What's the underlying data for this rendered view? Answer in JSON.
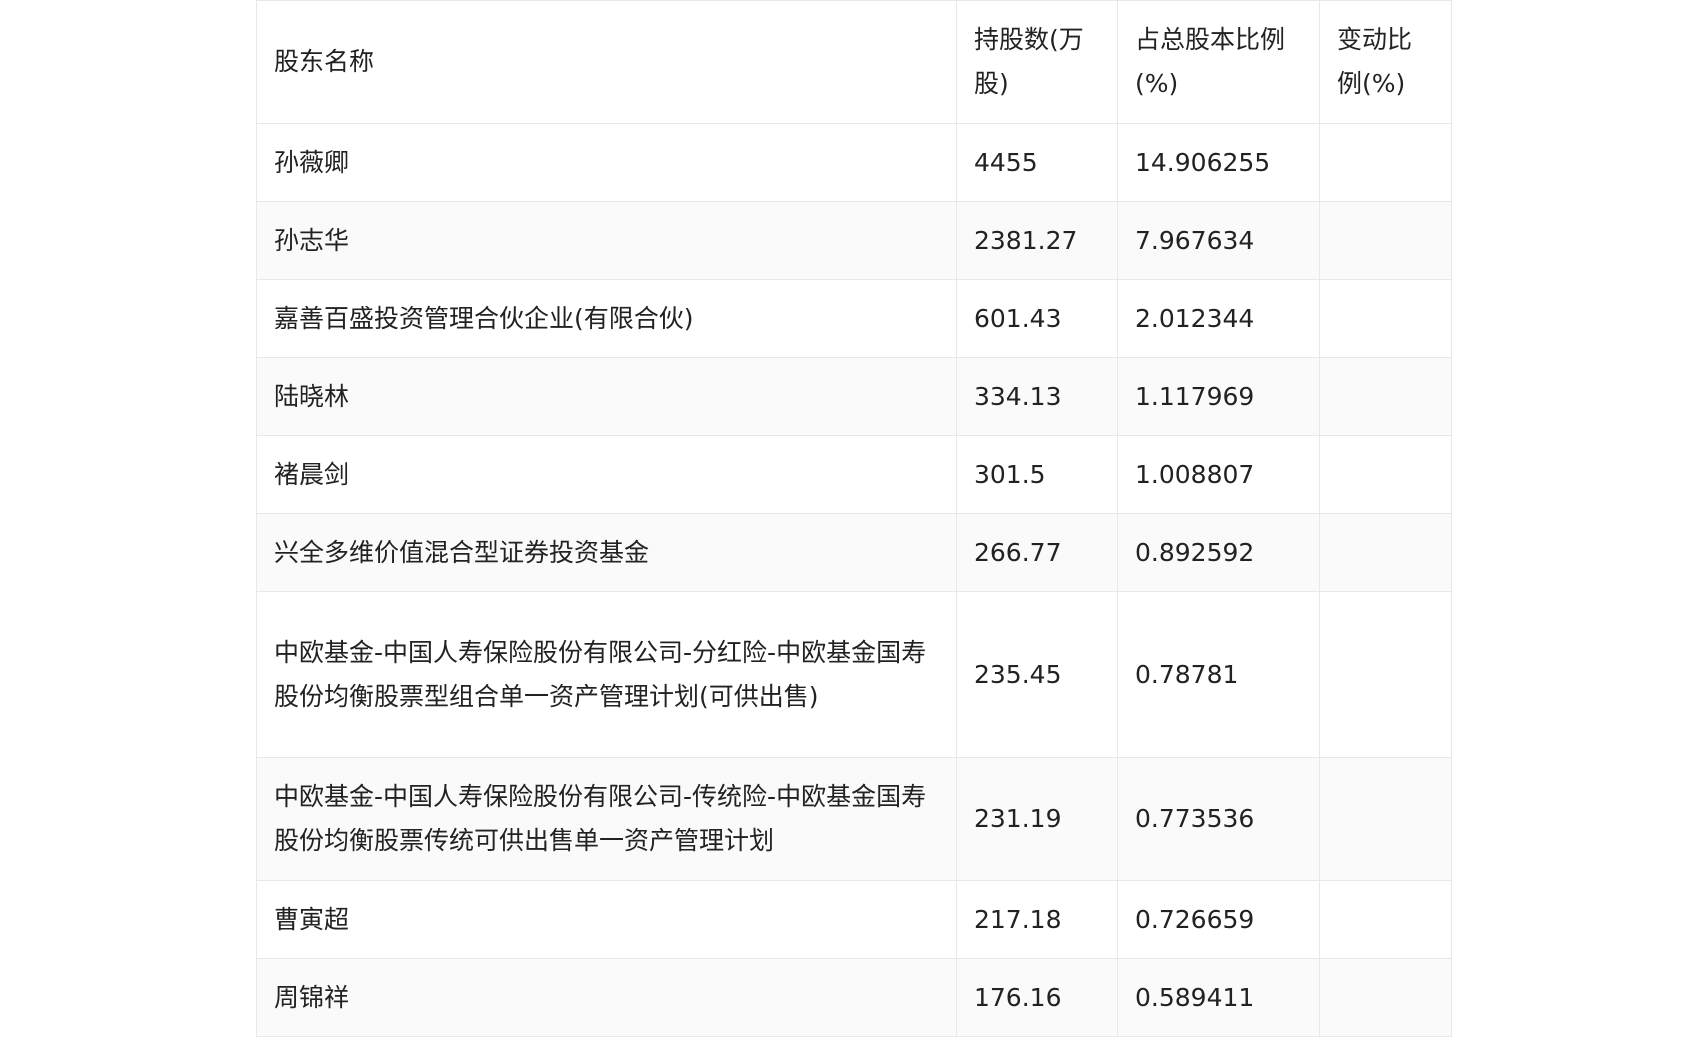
{
  "table": {
    "headers": [
      "股东名称",
      "持股数(万股)",
      "占总股本比例(%)",
      "变动比例(%)"
    ],
    "rows": [
      {
        "name": "孙薇卿",
        "shares": "4455",
        "ratio": "14.906255",
        "change": ""
      },
      {
        "name": "孙志华",
        "shares": "2381.27",
        "ratio": "7.967634",
        "change": ""
      },
      {
        "name": "嘉善百盛投资管理合伙企业(有限合伙)",
        "shares": "601.43",
        "ratio": "2.012344",
        "change": ""
      },
      {
        "name": "陆晓林",
        "shares": "334.13",
        "ratio": "1.117969",
        "change": ""
      },
      {
        "name": "褚晨剑",
        "shares": "301.5",
        "ratio": "1.008807",
        "change": ""
      },
      {
        "name": "兴全多维价值混合型证券投资基金",
        "shares": "266.77",
        "ratio": "0.892592",
        "change": ""
      },
      {
        "name": "中欧基金-中国人寿保险股份有限公司-分红险-中欧基金国寿股份均衡股票型组合单一资产管理计划(可供出售)",
        "shares": "235.45",
        "ratio": "0.78781",
        "change": ""
      },
      {
        "name": "中欧基金-中国人寿保险股份有限公司-传统险-中欧基金国寿股份均衡股票传统可供出售单一资产管理计划",
        "shares": "231.19",
        "ratio": "0.773536",
        "change": ""
      },
      {
        "name": "曹寅超",
        "shares": "217.18",
        "ratio": "0.726659",
        "change": ""
      },
      {
        "name": "周锦祥",
        "shares": "176.16",
        "ratio": "0.589411",
        "change": ""
      }
    ]
  }
}
